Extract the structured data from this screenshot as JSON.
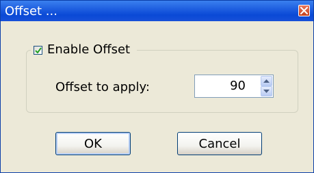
{
  "dialog": {
    "title": "Offset ...",
    "close_icon": "close-icon"
  },
  "group": {
    "checkbox_label": "Enable Offset",
    "checked": true
  },
  "offset": {
    "label": "Offset to apply:",
    "value": "90"
  },
  "buttons": {
    "ok": "OK",
    "cancel": "Cancel"
  },
  "colors": {
    "titlebar": "#0a49d6",
    "window_bg": "#ece9d8",
    "close_button": "#c4401c",
    "checkmark": "#21a121"
  }
}
